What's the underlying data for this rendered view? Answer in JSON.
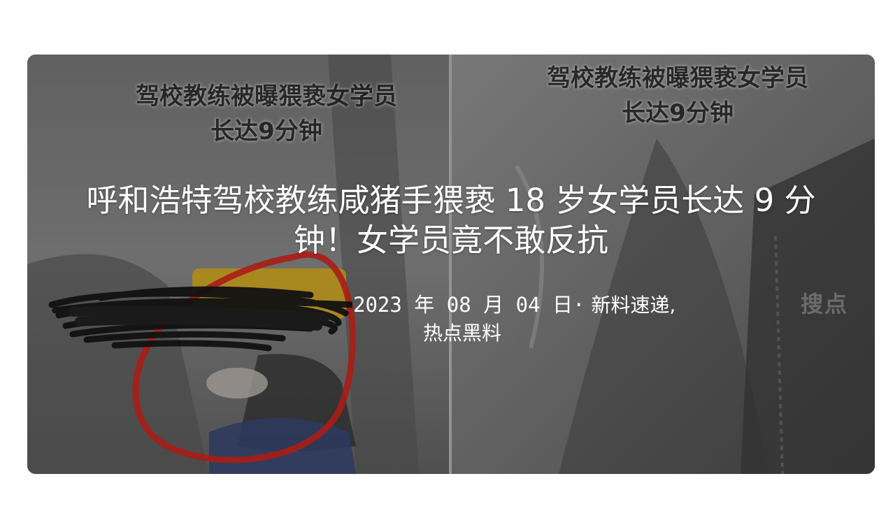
{
  "post": {
    "title": "呼和浩特驾校教练咸猪手猥亵 18 岁女学员长达 9 分钟！女学员竟不敢反抗",
    "date": "2023 年 08 月 04 日·",
    "categories": [
      {
        "label": "新料速递,",
        "separator": ""
      },
      {
        "label": "热点黑料"
      }
    ]
  },
  "image": {
    "captions_left": [
      "驾校教练被曝猥亵女学员",
      "长达9分钟"
    ],
    "captions_right": [
      "驾校教练被曝猥亵女学员",
      "长达9分钟"
    ],
    "watermark": "搜点"
  },
  "colors": {
    "title": "#ffffff",
    "highlight_circle": "#d8261c",
    "redaction": "#111111"
  }
}
